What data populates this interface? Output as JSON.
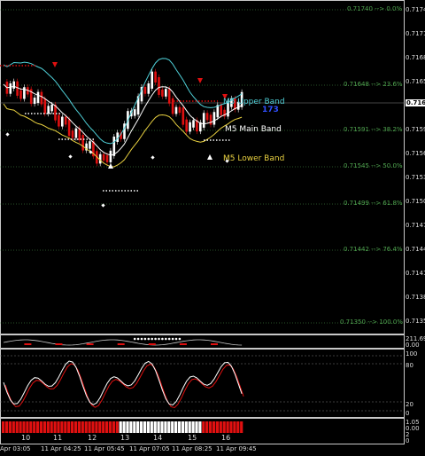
{
  "price_axis": {
    "ticks": [
      "0.7174",
      "0.7171",
      "0.7168",
      "0.7165",
      "0.7159",
      "0.7156",
      "0.7153",
      "0.7150",
      "0.7147",
      "0.7144",
      "0.7141",
      "0.7138",
      "0.7135"
    ],
    "current": "0.7162"
  },
  "fib_levels": [
    {
      "label": "0.71740 --> 0.0%"
    },
    {
      "label": "0.71648 --> 23.6%"
    },
    {
      "label": "0.71591 --> 38.2%"
    },
    {
      "label": "0.71545 --> 50.0%"
    },
    {
      "label": "0.71499 --> 61.8%"
    },
    {
      "label": "0.71442 --> 76.4%"
    },
    {
      "label": "0.71350 --> 100.0%"
    }
  ],
  "bands": {
    "upper": "M5 Upper Band",
    "main": "M5 Main Band",
    "lower": "M5 Lower Band",
    "overlay": "173"
  },
  "sub1_axis": {
    "a": "211.696",
    "b": "0.00"
  },
  "sub2_axis": {
    "top": "100",
    "mid": "80",
    "low": "20",
    "bottom": "0"
  },
  "sub3_axis": {
    "a": "1.05",
    "b": "0.00",
    "c": "2",
    "d": "0"
  },
  "day_labels": [
    "10",
    "11",
    "12",
    "13",
    "14",
    "15",
    "16"
  ],
  "time_labels": [
    "Apr 03:05",
    "11 Apr 04:25",
    "11 Apr 05:45",
    "11 Apr 07:05",
    "11 Apr 08:25",
    "11 Apr 09:45"
  ],
  "colors": {
    "up": "#ffffff",
    "down": "#e01010",
    "upper_band": "#4fd0d8",
    "main_band": "#ffffff",
    "lower_band": "#e8d040",
    "fib": "#4fa34f"
  }
}
